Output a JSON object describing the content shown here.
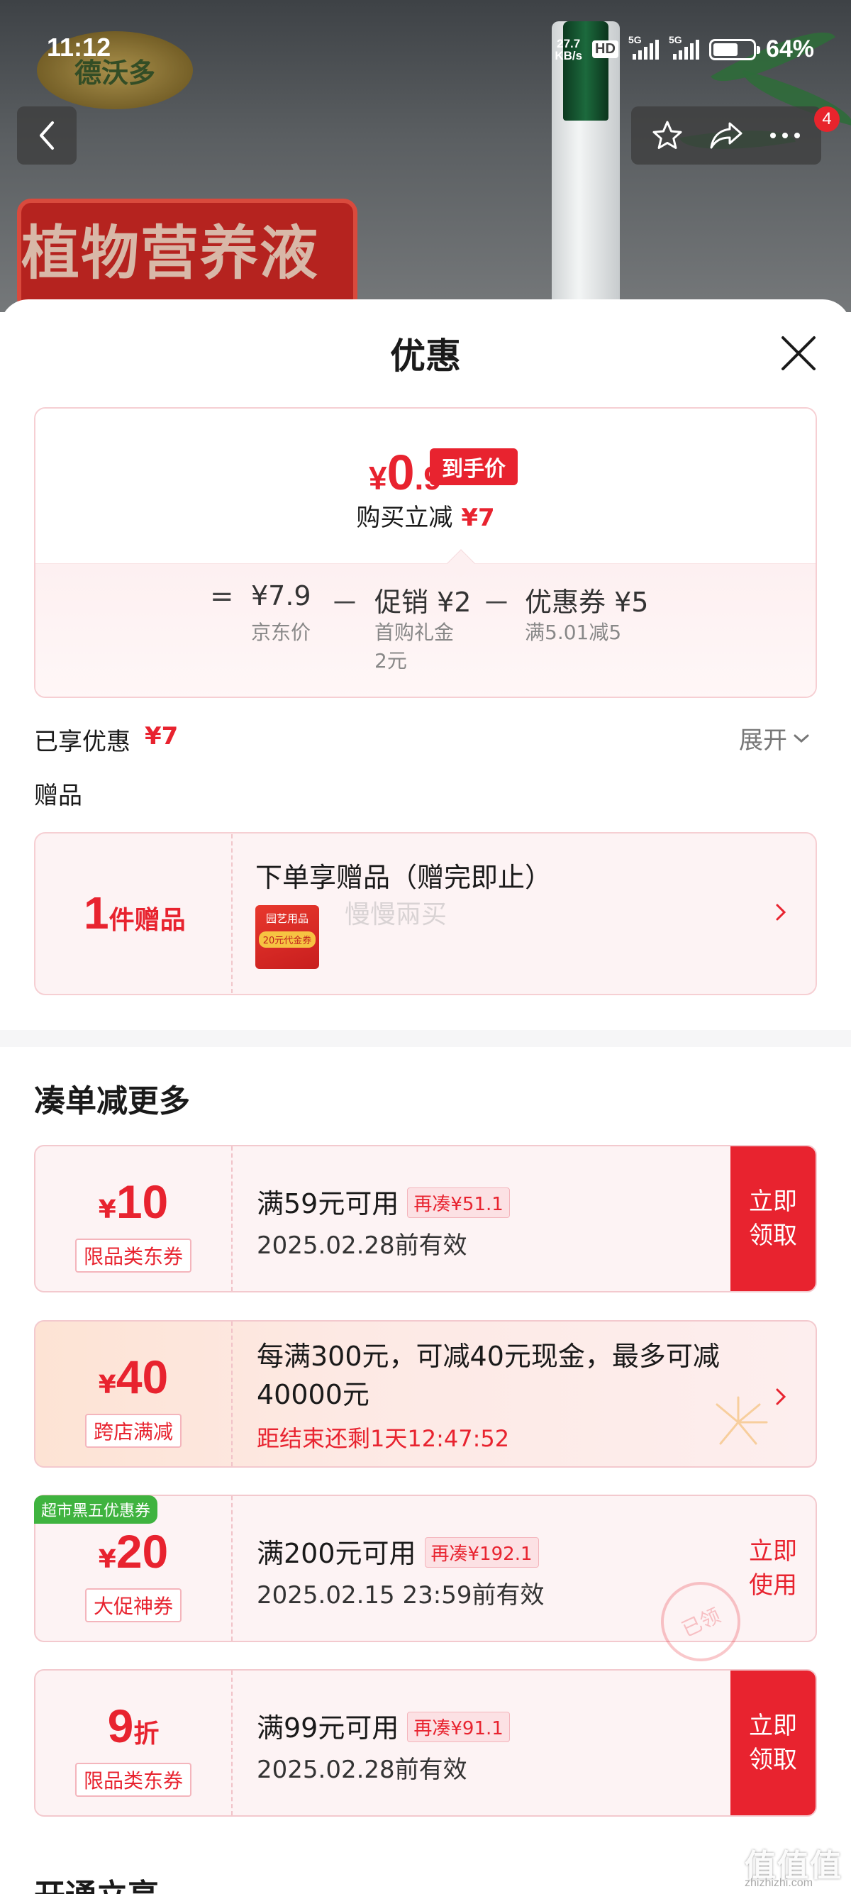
{
  "status_bar": {
    "time": "11:12",
    "net_speed_value": "27.7",
    "net_speed_unit": "KB/s",
    "hd": "HD",
    "sim1": "5G",
    "sim2": "5G",
    "battery_level": 0.64,
    "battery_text": "64%"
  },
  "backdrop": {
    "brand_logo_text": "德沃多",
    "promo_text": "植物营养液",
    "message_count": "4"
  },
  "sheet": {
    "title": "优惠"
  },
  "price_card": {
    "currency": "¥",
    "final_int": "0",
    "final_dec": ".9",
    "final_tag": "到手价",
    "reduce_label": "购买立减",
    "reduce_amount": "¥7",
    "equals": "=",
    "minus": "－",
    "items": [
      {
        "value": "¥7.9",
        "label": "京东价"
      },
      {
        "value": "促销 ¥2",
        "label": "首购礼金",
        "label2": "2元"
      },
      {
        "value": "优惠券 ¥5",
        "label": "满5.01减5"
      }
    ]
  },
  "summary": {
    "enjoyed_label": "已享优惠",
    "enjoyed_amount": "¥7",
    "expand_label": "展开",
    "gift_label": "赠品"
  },
  "gift": {
    "count": "1",
    "count_unit": "件赠品",
    "title": "下单享赠品（赠完即止）",
    "thumb_title": "园艺用品",
    "thumb_sub": "20元代金券",
    "faint_text": "慢慢兩买"
  },
  "more": {
    "section_title": "凑单减更多",
    "coupons": [
      {
        "currency": "¥",
        "amount": "10",
        "type": "限品类东券",
        "condition": "满59元可用",
        "add_more": "再凑¥51.1",
        "expiry": "2025.02.28前有效",
        "action_1": "立即",
        "action_2": "领取"
      },
      {
        "currency": "¥",
        "amount": "40",
        "type": "跨店满减",
        "desc": "每满300元，可减40元现金，最多可减40000元",
        "countdown": "距结束还剩1天12:47:52"
      },
      {
        "corner_tag": "超市黑五优惠券",
        "currency": "¥",
        "amount": "20",
        "type": "大促神券",
        "condition": "满200元可用",
        "add_more": "再凑¥192.1",
        "expiry": "2025.02.15 23:59前有效",
        "action_1": "立即",
        "action_2": "使用",
        "stamp": "已领"
      },
      {
        "amount": "9",
        "suffix": "折",
        "type": "限品类东券",
        "condition": "满99元可用",
        "add_more": "再凑¥91.1",
        "expiry": "2025.02.28前有效",
        "action_1": "立即",
        "action_2": "领取"
      }
    ],
    "next_section_title": "开通立享"
  },
  "watermark": {
    "text": "值值值",
    "sub": "zhizhizhi.com"
  },
  "colors": {
    "accent": "#e8232f",
    "card_border": "#f6cfd3",
    "card_bg": "#fdf3f4",
    "tag_green": "#3fb33f"
  },
  "icons": {
    "back": "chevron-left-icon",
    "favorite": "star-icon",
    "share": "share-icon",
    "more": "more-dots-icon",
    "close": "close-icon",
    "expand": "chevron-down-icon",
    "arrow": "chevron-right-icon"
  }
}
